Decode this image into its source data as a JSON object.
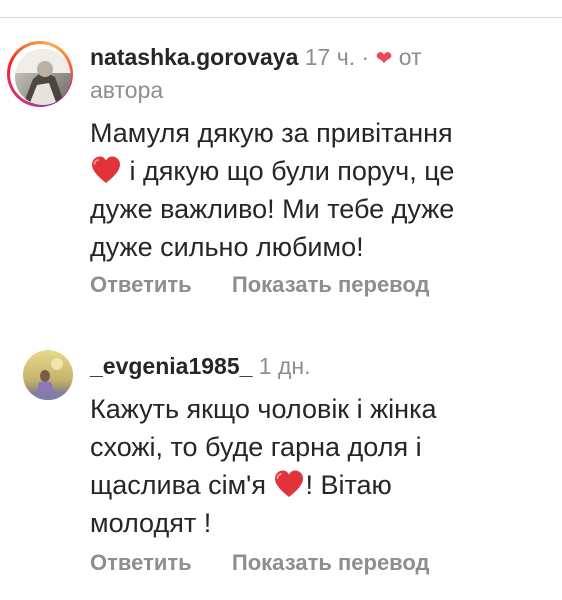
{
  "comments": [
    {
      "username": "natashka.gorovaya",
      "time": "17 ч.",
      "dot": "·",
      "author_like": "от",
      "author_like_line2": "автора",
      "text_lines": [
        "Мамуля дякую за привітання",
        " і дякую що були поруч, це",
        "дуже важливо! Ми тебе дуже",
        "дуже сильно любимо!"
      ],
      "reply_label": "Ответить",
      "translate_label": "Показать перевод",
      "avatar_icon": "user-avatar-photo",
      "story_ring": true
    },
    {
      "username": "_evgenia1985_",
      "time": "1 дн.",
      "text_lines": [
        "Кажуть якщо чоловік і жінка",
        "схожі, то буде гарна доля і",
        "щаслива сім'я ",
        "! Вітаю",
        "молодят !"
      ],
      "reply_label": "Ответить",
      "translate_label": "Показать перевод",
      "avatar_icon": "user-avatar-photo",
      "story_ring": false
    }
  ],
  "colors": {
    "text": "#262626",
    "secondary": "#8e8e8e",
    "heart": "#ed4956",
    "divider": "#dbdbdb"
  },
  "icons": {
    "heart_small": "heart-icon",
    "heart_emoji": "red-heart-emoji"
  }
}
